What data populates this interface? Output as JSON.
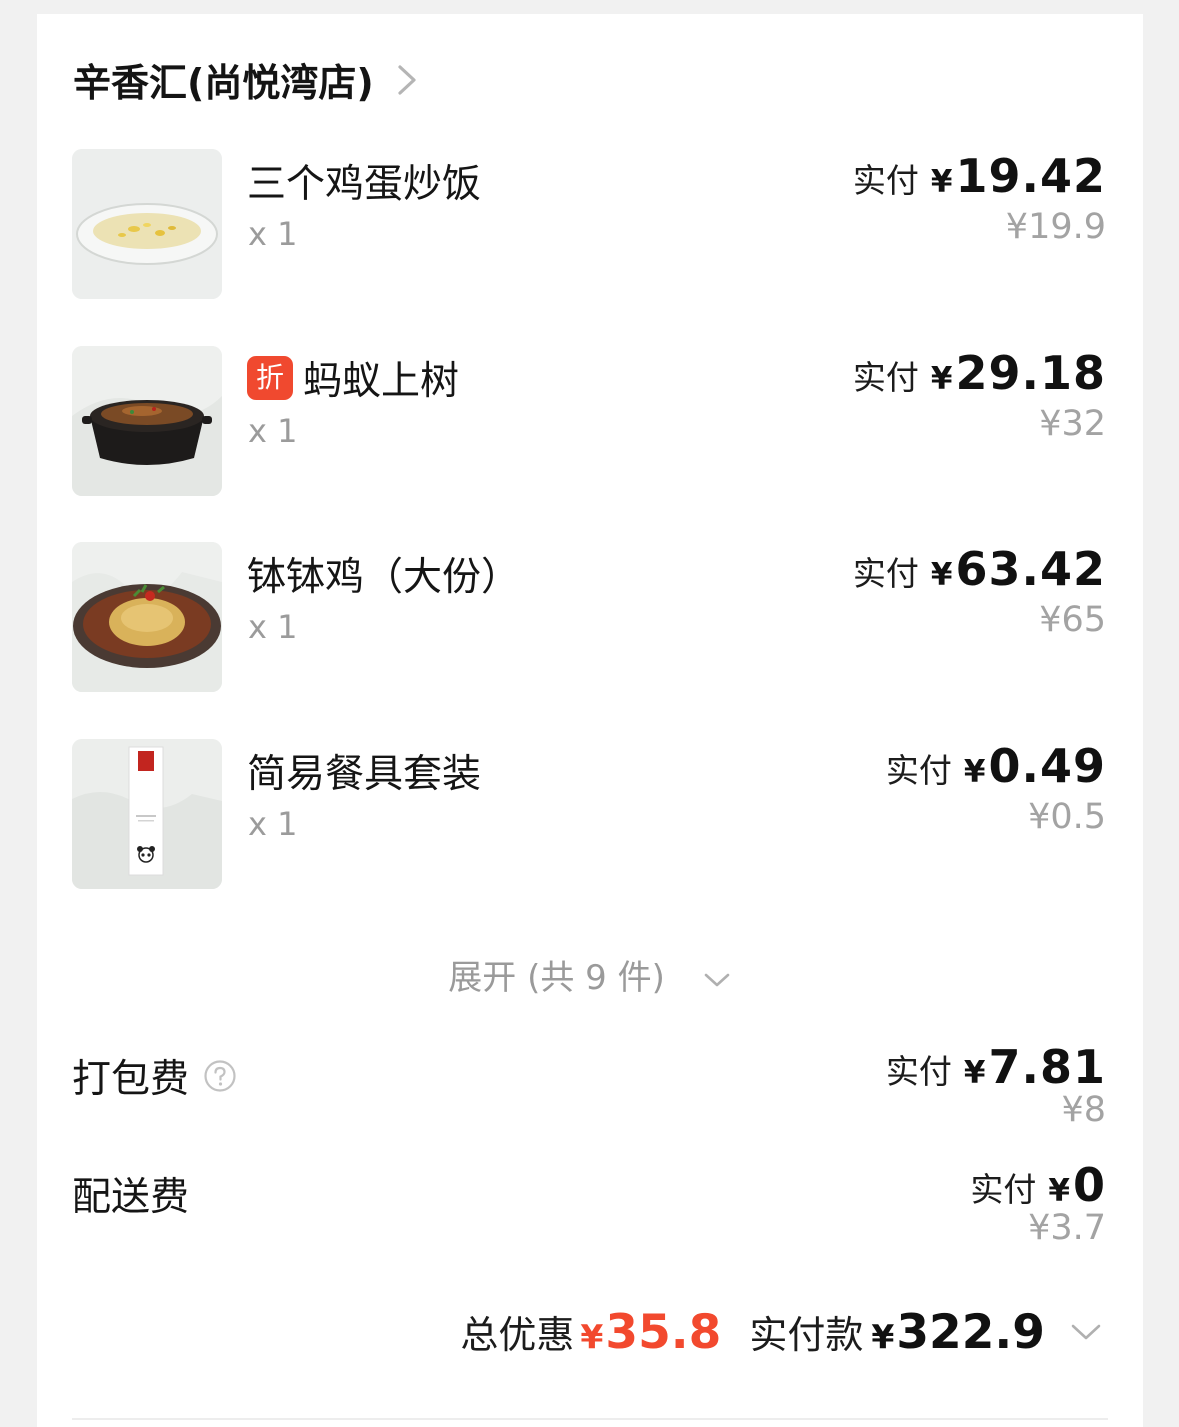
{
  "store": {
    "name": "辛香汇(尚悦湾店)"
  },
  "items": [
    {
      "name": "三个鸡蛋炒饭",
      "qty": "x 1",
      "paid_label": "实付",
      "currency": "¥",
      "paid": "19.42",
      "original": "¥19.9",
      "tag": ""
    },
    {
      "name": "蚂蚁上树",
      "qty": "x 1",
      "paid_label": "实付",
      "currency": "¥",
      "paid": "29.18",
      "original": "¥32",
      "tag": "折"
    },
    {
      "name": "钵钵鸡（大份）",
      "qty": "x 1",
      "paid_label": "实付",
      "currency": "¥",
      "paid": "63.42",
      "original": "¥65",
      "tag": ""
    },
    {
      "name": "简易餐具套装",
      "qty": "x 1",
      "paid_label": "实付",
      "currency": "¥",
      "paid": "0.49",
      "original": "¥0.5",
      "tag": ""
    }
  ],
  "expand": {
    "label": "展开 (共 9 件)"
  },
  "fees": {
    "packing": {
      "label": "打包费",
      "paid_label": "实付",
      "currency": "¥",
      "paid": "7.81",
      "original": "¥8"
    },
    "delivery": {
      "label": "配送费",
      "paid_label": "实付",
      "currency": "¥",
      "paid": "0",
      "original": "¥3.7"
    }
  },
  "summary": {
    "discount_label": "总优惠",
    "discount_currency": "¥",
    "discount": "35.8",
    "paid_label": "实付款",
    "paid_currency": "¥",
    "paid": "322.9"
  },
  "colors": {
    "accent_red": "#f2492e",
    "tag_red": "#f0492f",
    "muted": "#9b9b9b"
  },
  "icons": {
    "store_chevron": "chevron-right-icon",
    "expand_chevron": "chevron-down-icon",
    "help": "question-circle-icon",
    "summary_chevron": "chevron-down-icon"
  }
}
